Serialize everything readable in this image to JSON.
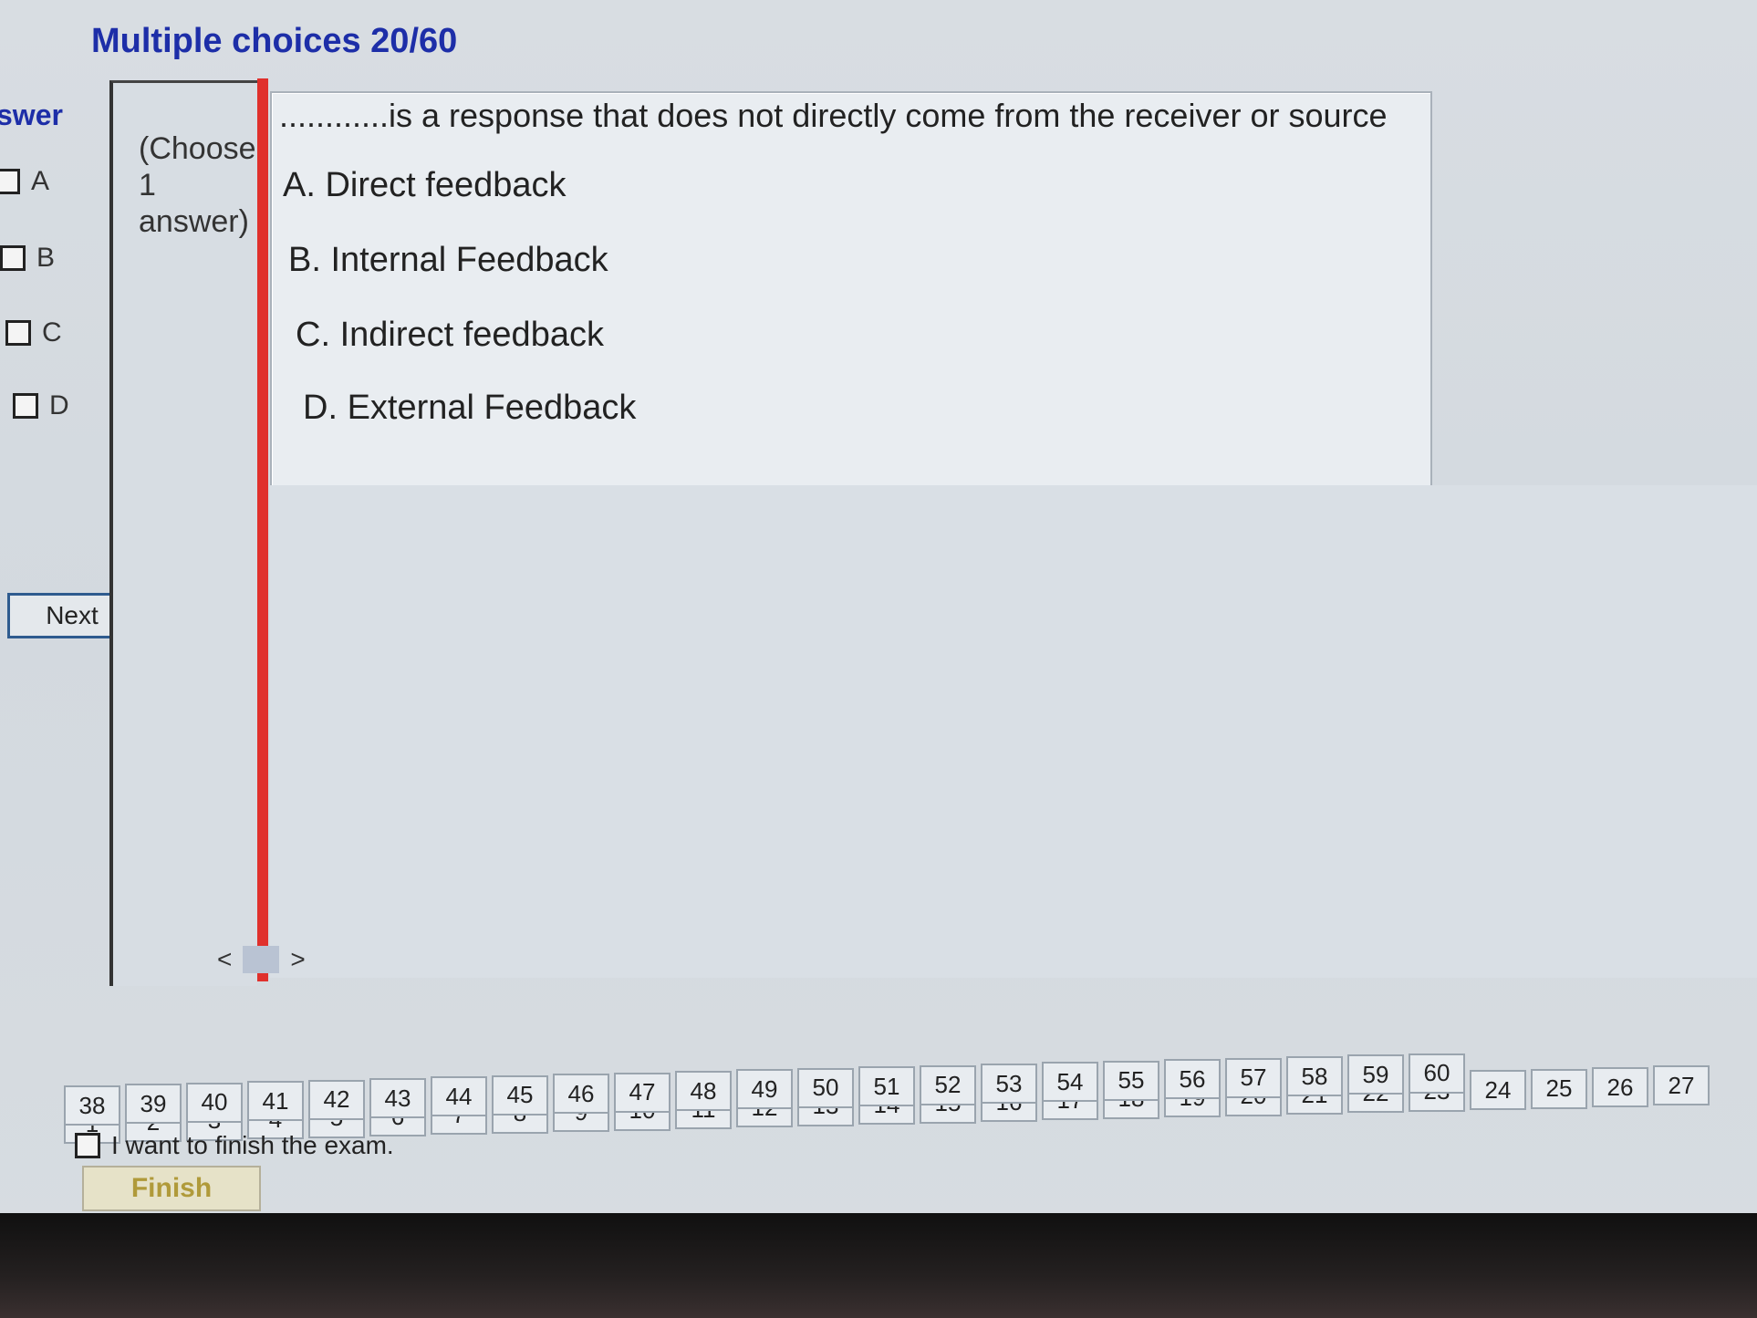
{
  "header": {
    "title": "Multiple choices 20/60",
    "answer_label": "swer"
  },
  "answer_choices": [
    {
      "label": "A",
      "checked": false
    },
    {
      "label": "B",
      "checked": false
    },
    {
      "label": "C",
      "checked": false
    },
    {
      "label": "D",
      "checked": false
    }
  ],
  "next_label": "Next",
  "instruction": "(Choose\n1\nanswer)",
  "question": {
    "text": "............is a response that does not directly come from the receiver or source",
    "options": [
      {
        "letter": "A.",
        "text": "Direct feedback"
      },
      {
        "letter": "B.",
        "text": "Internal Feedback"
      },
      {
        "letter": "C.",
        "text": "Indirect feedback"
      },
      {
        "letter": "D.",
        "text": "External Feedback"
      }
    ]
  },
  "nav": {
    "prev": "<",
    "next": ">"
  },
  "question_numbers": {
    "row1": [
      "1",
      "2",
      "3",
      "4",
      "5",
      "6",
      "7",
      "8",
      "9",
      "10",
      "11",
      "12",
      "13",
      "14",
      "15",
      "16",
      "17",
      "18",
      "19",
      "20",
      "21",
      "22",
      "23",
      "24",
      "25",
      "26",
      "27"
    ],
    "row2": [
      "38",
      "39",
      "40",
      "41",
      "42",
      "43",
      "44",
      "45",
      "46",
      "47",
      "48",
      "49",
      "50",
      "51",
      "52",
      "53",
      "54",
      "55",
      "56",
      "57",
      "58",
      "59",
      "60"
    ]
  },
  "finish": {
    "checkbox_label": "I want to finish the exam.",
    "button_label": "Finish"
  },
  "colors": {
    "title": "#1d2ea8",
    "red_bar": "#e0302c",
    "finish_text": "#b09a3a"
  },
  "icons": {
    "checkbox": "checkbox-icon",
    "prev": "chevron-left-icon",
    "next": "chevron-right-icon"
  }
}
